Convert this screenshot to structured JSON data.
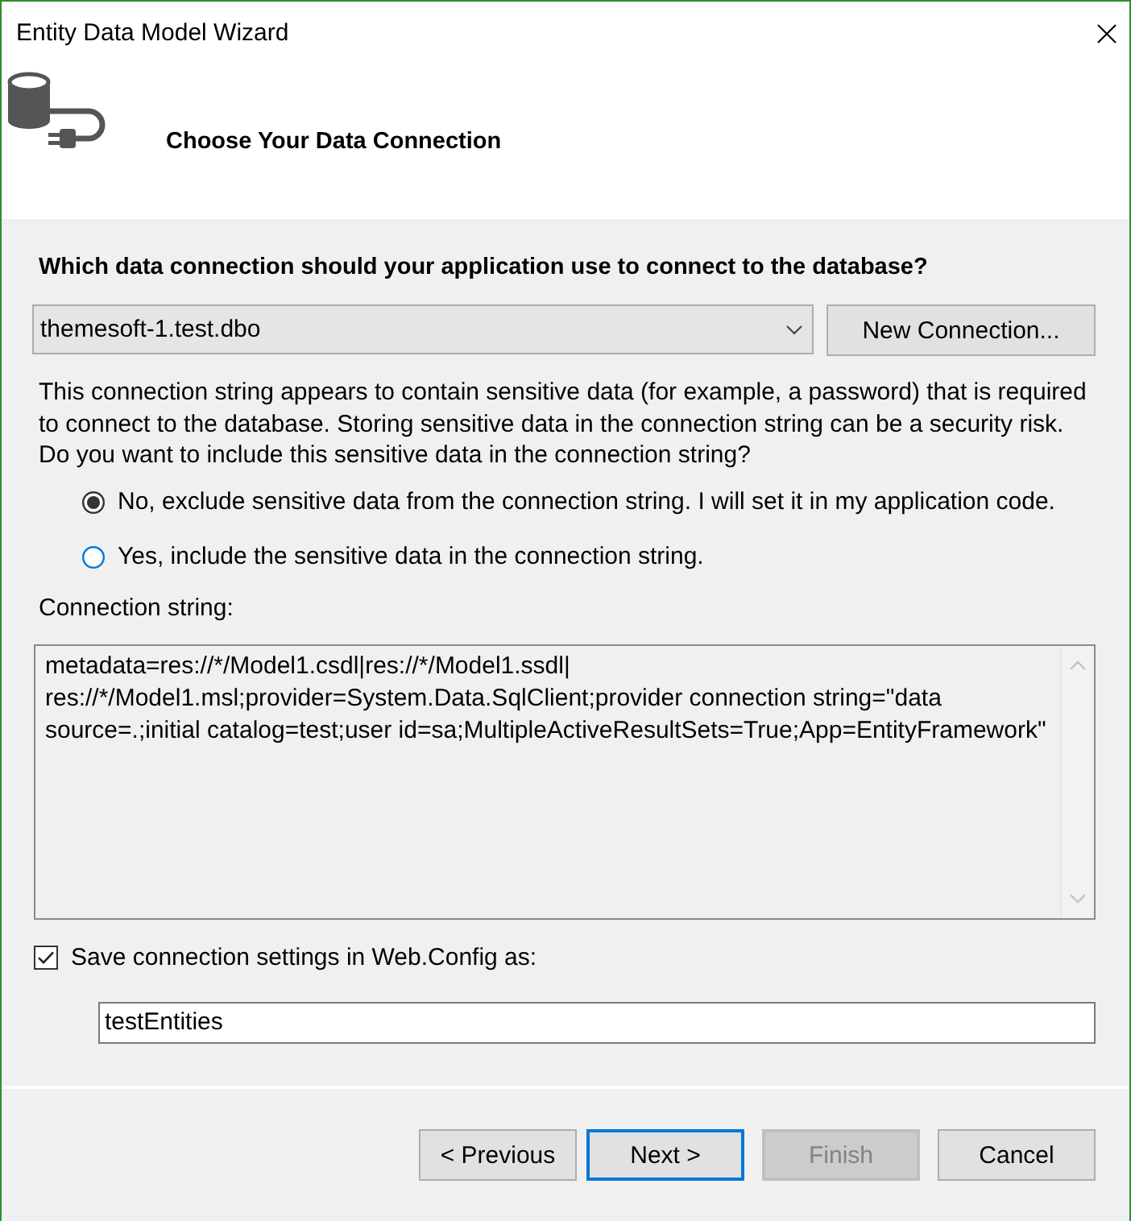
{
  "window": {
    "title": "Entity Data Model Wizard"
  },
  "header": {
    "title": "Choose Your Data Connection"
  },
  "question": "Which data connection should your application use to connect to the database?",
  "connection_dropdown": {
    "value": "themesoft-1.test.dbo"
  },
  "new_connection_button": {
    "label": "New Connection..."
  },
  "notice": "This connection string appears to contain sensitive data (for example, a password) that is required to connect to the database. Storing sensitive data in the connection string can be a security risk. Do you want to include this sensitive data in the connection string?",
  "options": [
    {
      "label": "No, exclude sensitive data from the connection string. I will set it in my application code.",
      "selected": true
    },
    {
      "label": "Yes, include the sensitive data in the connection string.",
      "selected": false
    }
  ],
  "connection_string": {
    "label": "Connection string:",
    "value": "metadata=res://*/Model1.csdl|res://*/Model1.ssdl|res://*/Model1.msl;provider=System.Data.SqlClient;provider connection string=\"data source=.;initial catalog=test;user id=sa;MultipleActiveResultSets=True;App=EntityFramework\""
  },
  "save_setting": {
    "label": "Save connection settings in Web.Config as:",
    "checked": true,
    "value": "testEntities"
  },
  "buttons": [
    {
      "label": "< Previous",
      "default": false,
      "disabled": false
    },
    {
      "label": "Next >",
      "default": true,
      "disabled": false
    },
    {
      "label": "Finish",
      "default": false,
      "disabled": true
    },
    {
      "label": "Cancel",
      "default": false,
      "disabled": false
    }
  ]
}
